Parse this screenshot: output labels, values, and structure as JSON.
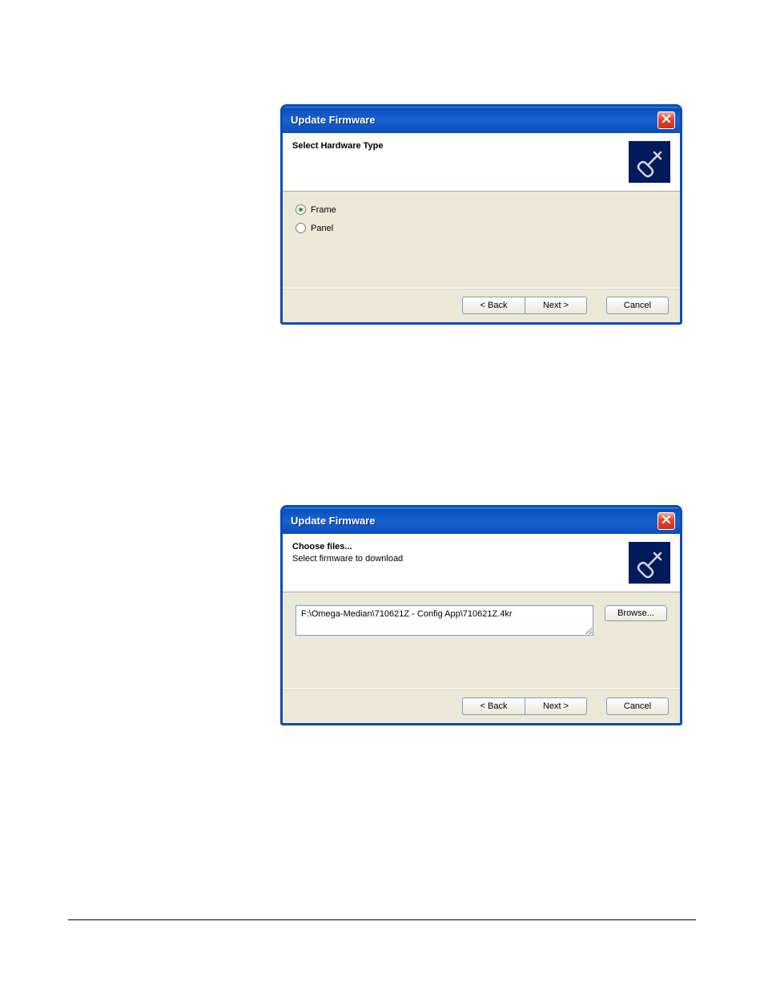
{
  "dialog1": {
    "title": "Update Firmware",
    "header": {
      "title": "Select Hardware Type",
      "subtitle": ""
    },
    "options": {
      "frame": "Frame",
      "panel": "Panel",
      "selected": "frame"
    },
    "buttons": {
      "back": "< Back",
      "next": "Next >",
      "cancel": "Cancel"
    }
  },
  "dialog2": {
    "title": "Update Firmware",
    "header": {
      "title": "Choose files...",
      "subtitle": "Select firmware to download"
    },
    "filepath": "F:\\Omega-Median\\710621Z - Config App\\710621Z.4kr",
    "browse": "Browse...",
    "buttons": {
      "back": "< Back",
      "next": "Next >",
      "cancel": "Cancel"
    }
  }
}
